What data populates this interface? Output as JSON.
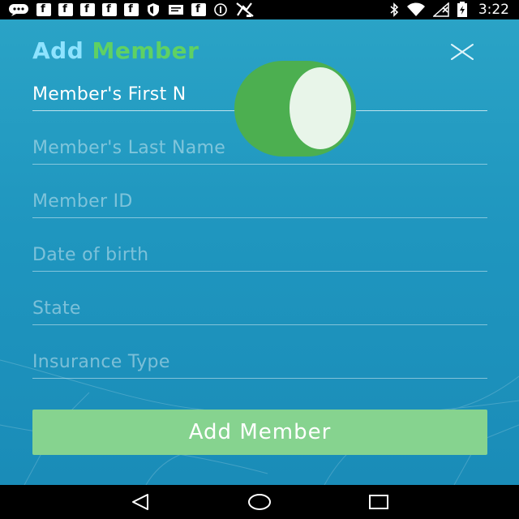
{
  "status_bar": {
    "time": "3:22",
    "left_icons": [
      "chat-icon",
      "facebook-icon",
      "facebook-icon",
      "facebook-icon",
      "facebook-icon",
      "facebook-icon",
      "shield-icon",
      "message-icon",
      "facebook-icon",
      "no-sim-icon",
      "signal-off-icon"
    ],
    "right_icons": [
      "bluetooth-icon",
      "wifi-icon",
      "cellular-icon",
      "battery-icon"
    ]
  },
  "header": {
    "title_part1": "Add",
    "title_part2": "Member",
    "title_color_1": "#8ee3ff",
    "title_color_2": "#5fd163"
  },
  "form": {
    "first_name": {
      "value": "Member's First N",
      "placeholder": "Member's First Name"
    },
    "last_name": {
      "value": "",
      "placeholder": "Member's Last Name"
    },
    "member_id": {
      "value": "",
      "placeholder": "Member ID"
    },
    "dob": {
      "value": "",
      "placeholder": "Date of birth"
    },
    "state": {
      "value": "",
      "placeholder": "State"
    },
    "insurance_type": {
      "value": "",
      "placeholder": "Insurance Type"
    }
  },
  "submit": {
    "label": "Add Member",
    "color": "#86d38f"
  },
  "colors": {
    "background": "#1f96bf",
    "toggle": "#4caf50"
  }
}
